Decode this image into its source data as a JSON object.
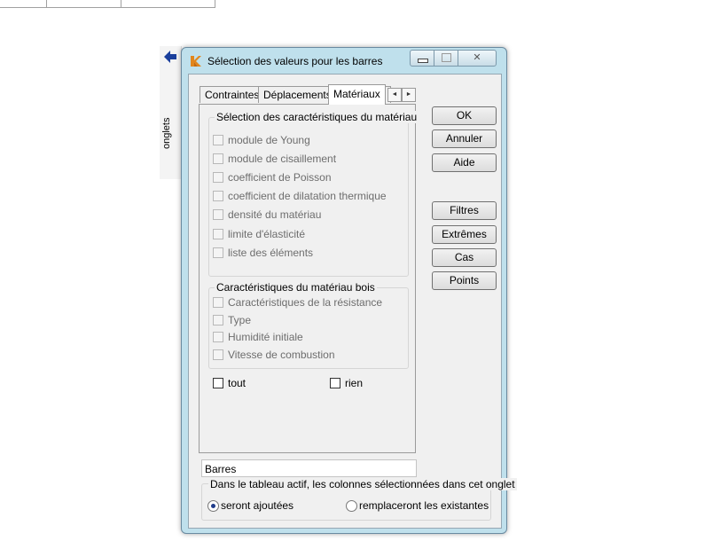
{
  "side_panel": {
    "label": "onglets",
    "arrow_icon": "left-arrow-icon"
  },
  "window": {
    "title": "Sélection des valeurs pour les barres",
    "app_icon": "app-logo-icon"
  },
  "tabs": [
    {
      "label": "Contraintes",
      "active": false
    },
    {
      "label": "Déplacements",
      "active": false
    },
    {
      "label": "Matériaux",
      "active": true
    }
  ],
  "tab_scroll": {
    "left": "◄",
    "right": "►"
  },
  "material_group": {
    "title": "Sélection des caractéristiques du matériau",
    "items": [
      "module de Young",
      "module de cisaillement",
      "coefficient de Poisson",
      "coefficient de dilatation thermique",
      "densité du matériau",
      "limite d'élasticité",
      "liste des éléments"
    ]
  },
  "wood_group": {
    "title": "Caractéristiques du matériau bois",
    "items": [
      "Caractéristiques de la résistance",
      "Type",
      "Humidité initiale",
      "Vitesse de combustion"
    ]
  },
  "select_all": {
    "tout": "tout",
    "rien": "rien"
  },
  "buttons": {
    "ok": "OK",
    "annuler": "Annuler",
    "aide": "Aide",
    "filtres": "Filtres",
    "extremes": "Extrêmes",
    "cas": "Cas",
    "points": "Points"
  },
  "field": {
    "value": "Barres"
  },
  "columns_group": {
    "title": "Dans le tableau actif, les colonnes sélectionnées dans cet onglet",
    "option_add": "seront ajoutées",
    "option_replace": "remplaceront les existantes",
    "selected": "add"
  },
  "colors": {
    "window_frame": "#bfe0ec",
    "client_bg": "#f0f0f0",
    "radio_dot": "#1f3c8a"
  }
}
